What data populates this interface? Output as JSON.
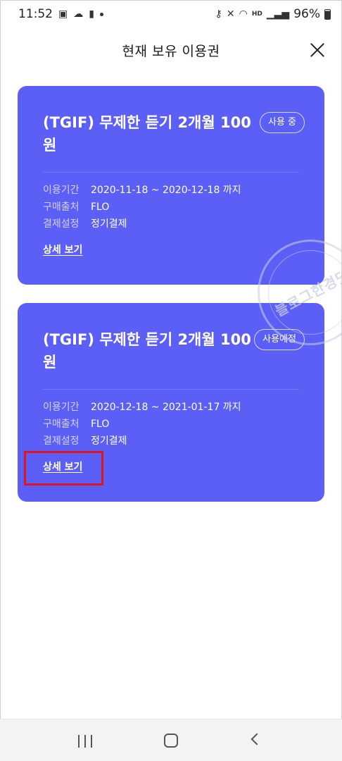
{
  "status_bar": {
    "time": "11:52",
    "battery": "96%",
    "network": "HD"
  },
  "header": {
    "title": "현재 보유 이용권"
  },
  "cards": [
    {
      "title": "(TGIF) 무제한 듣기 2개월 100원",
      "status": "사용 중",
      "period_label": "이용기간",
      "period_value": "2020-11-18 ~ 2020-12-18 까지",
      "source_label": "구매출처",
      "source_value": "FLO",
      "payment_label": "결제설정",
      "payment_value": "정기결제",
      "detail_link": "상세 보기"
    },
    {
      "title": "(TGIF) 무제한 듣기 2개월 100원",
      "status": "사용예정",
      "period_label": "이용기간",
      "period_value": "2020-12-18 ~ 2021-01-17 까지",
      "source_label": "구매출처",
      "source_value": "FLO",
      "payment_label": "결제설정",
      "payment_value": "정기결제",
      "detail_link": "상세 보기"
    }
  ],
  "watermark": {
    "text": "블로그한경닷"
  },
  "colors": {
    "card_bg": "#5b5ff5",
    "highlight": "#e0141e"
  }
}
